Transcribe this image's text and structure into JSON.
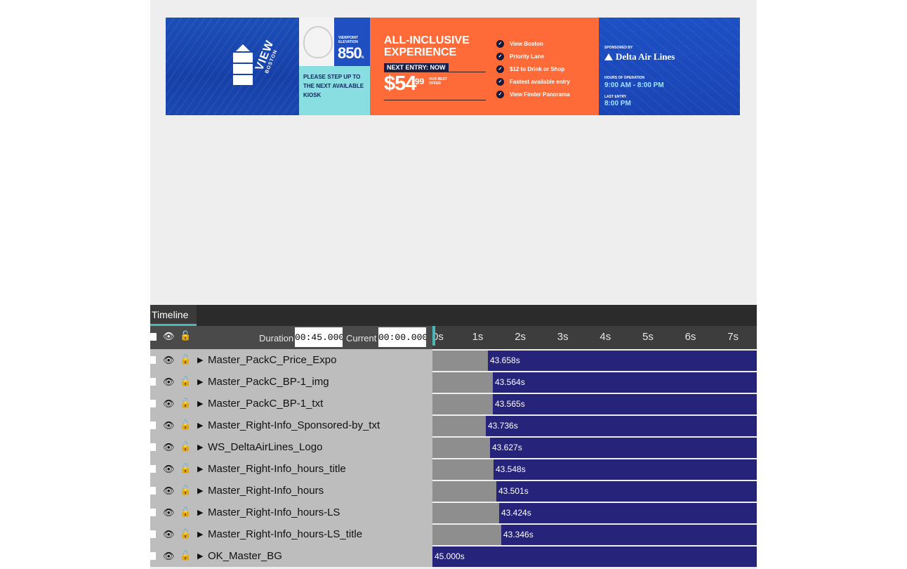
{
  "banner": {
    "logo_title": "VIEW",
    "logo_subtitle": "BOSTON",
    "elevation_label": "VIEWPOINT ELEVATION",
    "elevation_value": "850",
    "elevation_unit": "ft.",
    "step_up_text": "PLEASE STEP UP TO THE NEXT AVAILABLE KIOSK",
    "offer_title": "ALL-INCLUSIVE EXPERIENCE",
    "next_entry": "NEXT ENTRY: NOW",
    "price_dollars": "$54",
    "price_cents": "99",
    "price_note": "OUR BEST OFFER",
    "features": [
      "View Boston",
      "Priority Lane",
      "$12 to Drink or Shop",
      "Fastest available entry",
      "View Finder Panorama"
    ],
    "sponsored_label": "SPONSORED BY",
    "sponsor_name": "Delta Air Lines",
    "hours_label": "HOURS OF OPERATION",
    "hours_value": "9:00 AM - 8:00 PM",
    "last_entry_label": "LAST ENTRY",
    "last_entry_value": "8:00 PM"
  },
  "timeline": {
    "tab_label": "Timeline",
    "duration_label": "Duration",
    "duration_value": "00:45.000",
    "current_label": "Current",
    "current_value": "00:00.000",
    "ticks": [
      "0s",
      "1s",
      "2s",
      "3s",
      "4s",
      "5s",
      "6s",
      "7s"
    ],
    "tracks": [
      {
        "name": "Master_PackC_Price_Expo",
        "time": "43.658s",
        "start": 1.3
      },
      {
        "name": "Master_PackC_BP-1_img",
        "time": "43.564s",
        "start": 1.42
      },
      {
        "name": "Master_PackC_BP-1_txt",
        "time": "43.565s",
        "start": 1.42
      },
      {
        "name": "Master_Right-Info_Sponsored-by_txt",
        "time": "43.736s",
        "start": 1.26
      },
      {
        "name": "WS_DeltaAirLines_Logo",
        "time": "43.627s",
        "start": 1.36
      },
      {
        "name": "Master_Right-Info_hours_title",
        "time": "43.548s",
        "start": 1.44
      },
      {
        "name": "Master_Right-Info_hours",
        "time": "43.501s",
        "start": 1.5
      },
      {
        "name": "Master_Right-Info_hours-LS",
        "time": "43.424s",
        "start": 1.56
      },
      {
        "name": "Master_Right-Info_hours-LS_title",
        "time": "43.346s",
        "start": 1.62
      },
      {
        "name": "OK_Master_BG",
        "time": "45.000s",
        "start": 0
      }
    ]
  },
  "icons": {
    "eye": "eye-icon",
    "lock": "unlock-icon",
    "expand": "triangle-right-icon"
  },
  "colors": {
    "clip_bar": "#25237a",
    "playhead": "#4ab8b6",
    "banner_orange": "#ff6b38",
    "banner_blue": "#1d50c4"
  }
}
